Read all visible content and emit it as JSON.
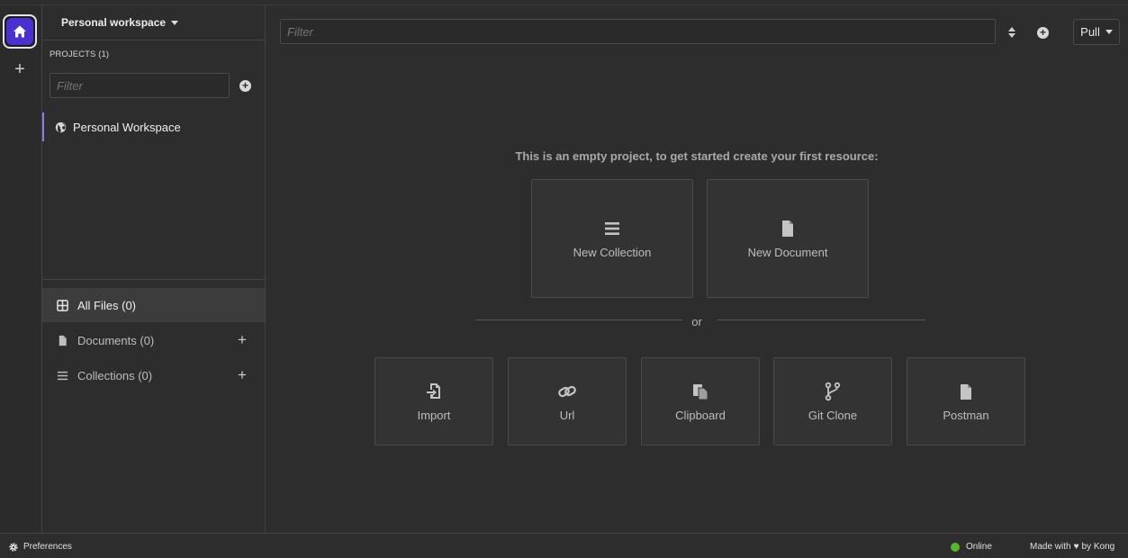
{
  "colors": {
    "accent": "#4a2fd1",
    "project_highlight": "#8c7ae6",
    "online": "#58b52d"
  },
  "sidebar": {
    "workspace_title": "Personal workspace",
    "projects_label": "PROJECTS (1)",
    "filter_placeholder": "Filter",
    "project_item": "Personal Workspace",
    "nav": [
      {
        "label": "All Files (0)",
        "icon": "grid-icon"
      },
      {
        "label": "Documents (0)",
        "icon": "document-icon"
      },
      {
        "label": "Collections (0)",
        "icon": "list-icon"
      }
    ]
  },
  "main": {
    "filter_placeholder": "Filter",
    "pull_label": "Pull",
    "empty_message": "This is an empty project, to get started create your first resource:",
    "or_label": "or",
    "create_cards": [
      {
        "label": "New Collection",
        "icon": "list-icon"
      },
      {
        "label": "New Document",
        "icon": "document-icon"
      }
    ],
    "import_cards": [
      {
        "label": "Import",
        "icon": "import-icon"
      },
      {
        "label": "Url",
        "icon": "link-icon"
      },
      {
        "label": "Clipboard",
        "icon": "clipboard-icon"
      },
      {
        "label": "Git Clone",
        "icon": "git-branch-icon"
      },
      {
        "label": "Postman",
        "icon": "document-icon"
      }
    ]
  },
  "statusbar": {
    "preferences": "Preferences",
    "online": "Online",
    "made_with": "Made with",
    "by_kong": "by Kong"
  }
}
